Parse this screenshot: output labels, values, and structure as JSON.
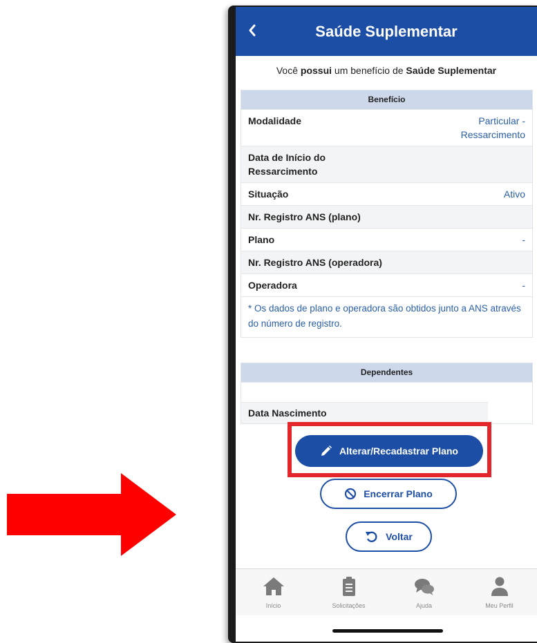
{
  "header": {
    "title": "Saúde Suplementar",
    "back_icon": "chevron-left-icon"
  },
  "intro": {
    "prefix": "Você ",
    "bold1": "possui",
    "middle": " um benefício de ",
    "bold2": "Saúde Suplementar"
  },
  "benefit": {
    "header": "Benefício",
    "rows": [
      {
        "label": "Modalidade",
        "value": "Particular -\nRessarcimento"
      },
      {
        "label": "Data de Início do\nRessarcimento",
        "value": ""
      },
      {
        "label": "Situação",
        "value": "Ativo"
      },
      {
        "label": "Nr. Registro ANS (plano)",
        "value": ""
      },
      {
        "label": "Plano",
        "value": "-"
      },
      {
        "label": "Nr. Registro ANS (operadora)",
        "value": ""
      },
      {
        "label": "Operadora",
        "value": "-"
      }
    ],
    "note": "* Os dados de plano e operadora são obtidos junto a ANS através do número de registro."
  },
  "dependents": {
    "header": "Dependentes",
    "row_label": "Data Nascimento"
  },
  "buttons": {
    "change_plan": "Alterar/Recadastrar Plano",
    "end_plan": "Encerrar Plano",
    "back": "Voltar"
  },
  "tabs": [
    {
      "label": "Início",
      "icon": "home-icon"
    },
    {
      "label": "Solicitações",
      "icon": "clipboard-icon"
    },
    {
      "label": "Ajuda",
      "icon": "chat-bubbles-icon"
    },
    {
      "label": "Meu Perfil",
      "icon": "user-icon"
    }
  ],
  "colors": {
    "primary": "#1c4ea6",
    "highlight": "#e2262a",
    "arrow": "#ff0000"
  }
}
